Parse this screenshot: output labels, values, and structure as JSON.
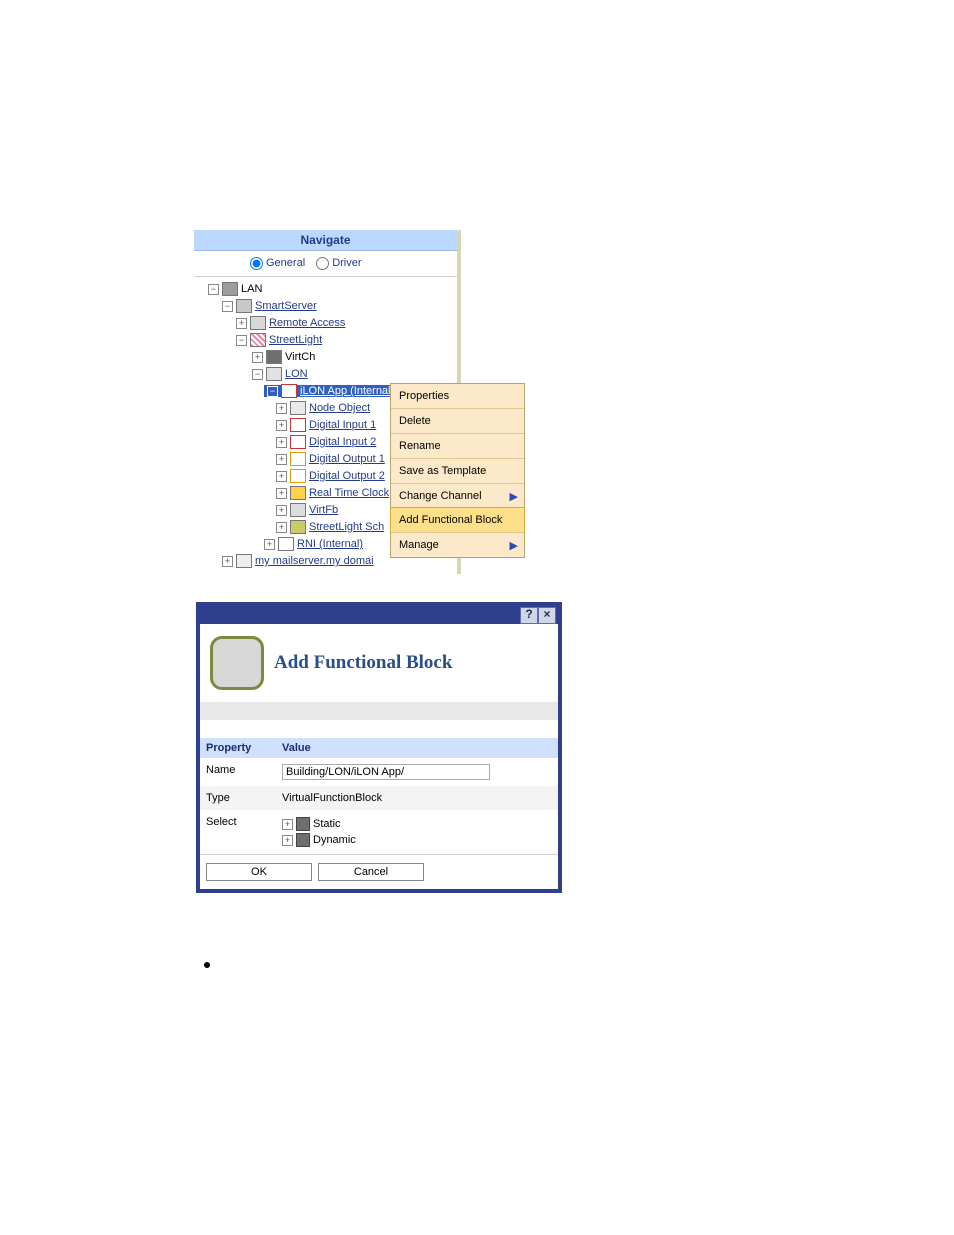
{
  "nav": {
    "title": "Navigate",
    "mode_general": "General",
    "mode_driver": "Driver",
    "tree": {
      "lan": "LAN",
      "smartserver": "SmartServer",
      "remote_access": "Remote Access",
      "streetlight": "StreetLight",
      "virtch": "VirtCh",
      "lon": "LON",
      "ilon_app": "iLON App (Internal)",
      "node_obj": "Node Object",
      "di1": "Digital Input 1",
      "di2": "Digital Input 2",
      "do1": "Digital Output 1",
      "do2": "Digital Output 2",
      "rtc": "Real Time Clock",
      "virtfb": "VirtFb",
      "sl_sch": "StreetLight Sch",
      "rni": "RNI (Internal)",
      "mailserver": "my mailserver.my domai"
    }
  },
  "ctx": {
    "properties": "Properties",
    "delete": "Delete",
    "rename": "Rename",
    "save_tpl": "Save as Template",
    "change_ch": "Change Channel",
    "add_fb": "Add Functional Block",
    "manage": "Manage"
  },
  "dlg": {
    "title": "Add Functional Block",
    "col_property": "Property",
    "col_value": "Value",
    "row_name": "Name",
    "name_value": "Building/LON/iLON App/",
    "row_type": "Type",
    "type_value": "VirtualFunctionBlock",
    "row_select": "Select",
    "select_static": "Static",
    "select_dynamic": "Dynamic",
    "ok": "OK",
    "cancel": "Cancel"
  }
}
